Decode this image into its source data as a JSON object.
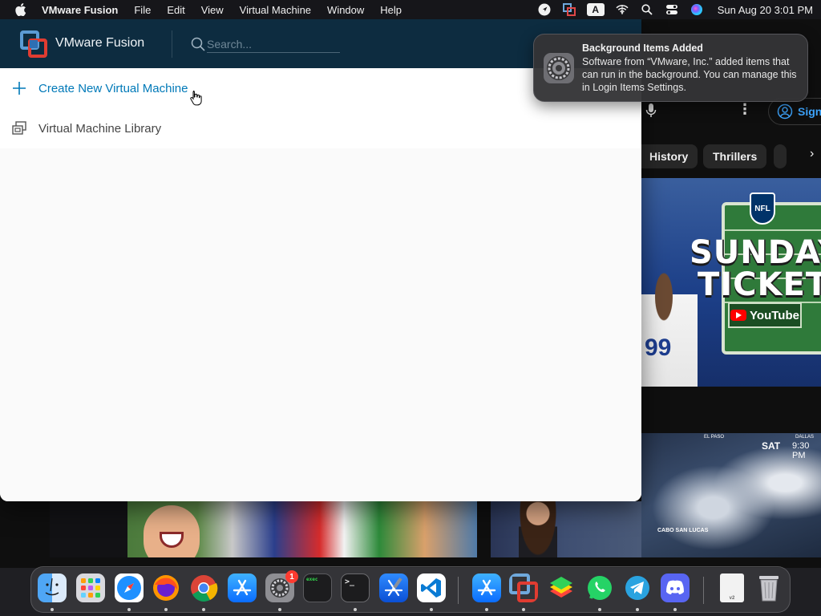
{
  "menubar": {
    "app_name": "VMware Fusion",
    "menus": [
      "File",
      "Edit",
      "View",
      "Virtual Machine",
      "Window",
      "Help"
    ],
    "clock": "Sun Aug 20  3:01 PM",
    "status_icons": [
      "location-icon",
      "vmware-status-icon",
      "input-source-icon",
      "wifi-icon",
      "spotlight-icon",
      "control-center-icon",
      "siri-icon"
    ],
    "input_source": "A"
  },
  "vmware": {
    "title": "VMware Fusion",
    "search_placeholder": "Search...",
    "create_label": "Create New Virtual Machine",
    "library_label": "Virtual Machine Library",
    "colors": {
      "header": "#0d2c40",
      "accent": "#0079b8"
    }
  },
  "notification": {
    "title": "Background Items Added",
    "body": "Software from “VMware, Inc.” added items that can run in the background. You can manage this in Login Items Settings."
  },
  "youtube": {
    "sign_in": "Sign",
    "chips": [
      "History",
      "Thrillers"
    ],
    "thumb_nfl": {
      "line1": "SUNDAY",
      "line2": "TICKET",
      "shield": "NFL",
      "brand": "YouTube"
    },
    "thumb_weather": {
      "day": "SAT",
      "time": "9:30 PM",
      "places": [
        "EL PASO",
        "DALLAS"
      ],
      "label": "CABO SAN LUCAS"
    }
  },
  "dock": {
    "items": [
      "finder-icon",
      "launchpad-icon",
      "safari-icon",
      "firefox-icon",
      "chrome-icon",
      "app-store-icon",
      "system-settings-icon",
      "console-icon",
      "terminal-icon",
      "xcode-icon",
      "vscode-icon",
      "simulator-icon",
      "vmware-fusion-icon",
      "bluestacks-icon",
      "whatsapp-icon",
      "telegram-icon",
      "discord-icon",
      "document-icon",
      "trash-icon"
    ],
    "settings_badge": "1",
    "console_label": "exec",
    "doc_label": "v2"
  }
}
